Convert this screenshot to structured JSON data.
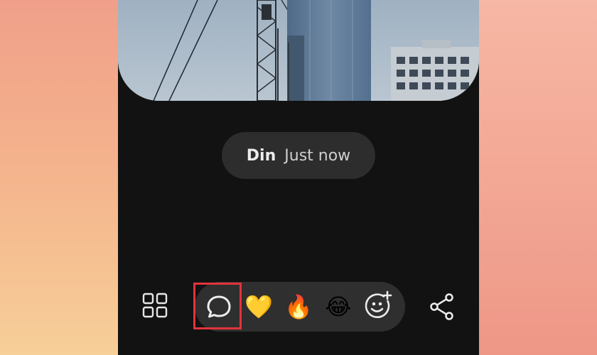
{
  "post": {
    "author": "Din",
    "timestamp": "Just now"
  },
  "toolbar": {
    "grid_icon": "grid-icon",
    "comment_icon": "chat-bubble-icon",
    "reactions": [
      {
        "name": "yellow-heart",
        "glyph": "💛"
      },
      {
        "name": "fire",
        "glyph": "🔥"
      },
      {
        "name": "tears-of-joy",
        "glyph": "😂"
      }
    ],
    "add_reaction_icon": "smiley-plus-icon",
    "share_icon": "share-icon"
  },
  "colors": {
    "highlight": "#e3343b",
    "phone_background": "#121212",
    "pill_background": "#2d2d2d"
  }
}
